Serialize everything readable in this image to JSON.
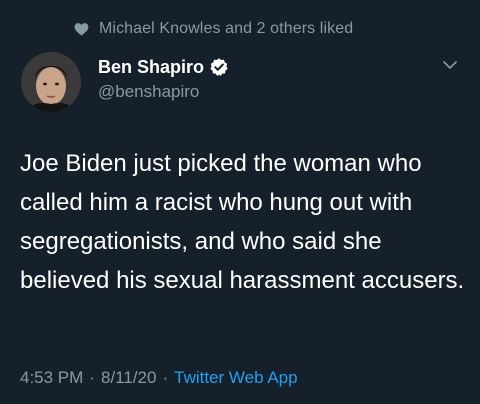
{
  "social_context": {
    "text": "Michael Knowles and 2 others liked",
    "icon": "heart-icon"
  },
  "author": {
    "display_name": "Ben Shapiro",
    "handle": "@benshapiro",
    "verified": true,
    "verified_icon": "verified-badge-icon"
  },
  "menu": {
    "icon": "chevron-down-icon"
  },
  "tweet": {
    "text": "Joe Biden just picked the woman who called him a racist who hung out with segregationists, and who said she believed his sexual harassment accusers."
  },
  "meta": {
    "time": "4:53 PM",
    "date": "8/11/20",
    "separator": "·",
    "source": "Twitter Web App"
  },
  "colors": {
    "background": "#15202b",
    "secondary_text": "#8899a6",
    "link": "#1da1f2",
    "primary_text": "#ffffff"
  }
}
